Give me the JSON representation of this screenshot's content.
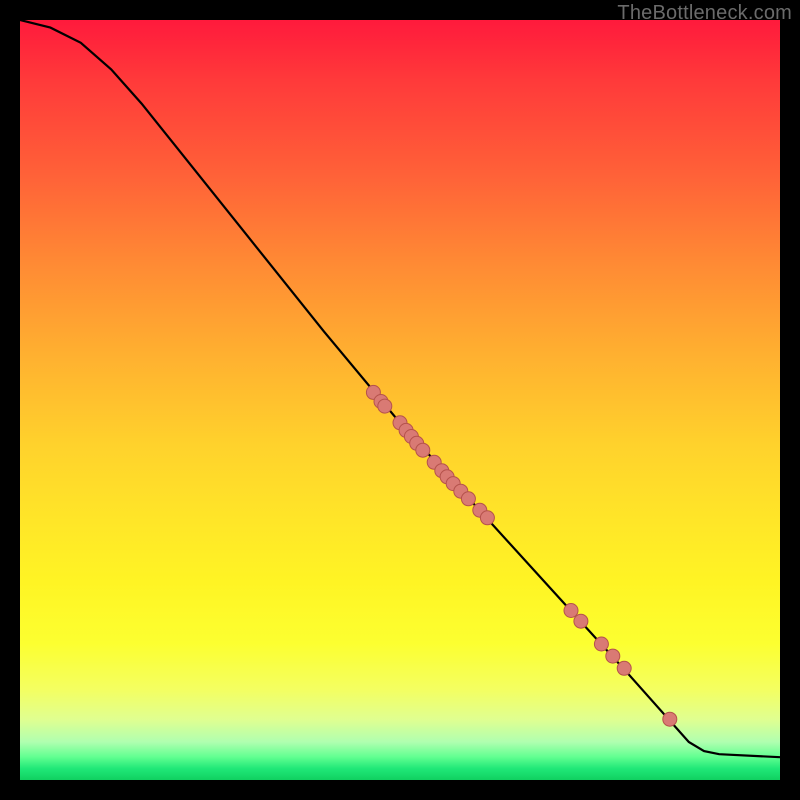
{
  "watermark": "TheBottleneck.com",
  "colors": {
    "point_fill": "#d97a74",
    "point_stroke": "#b5524c",
    "curve": "#000000"
  },
  "chart_data": {
    "type": "line",
    "title": "",
    "xlabel": "",
    "ylabel": "",
    "xlim": [
      0,
      100
    ],
    "ylim": [
      0,
      100
    ],
    "curve": [
      {
        "x": 0,
        "y": 100
      },
      {
        "x": 4,
        "y": 99
      },
      {
        "x": 8,
        "y": 97
      },
      {
        "x": 12,
        "y": 93.5
      },
      {
        "x": 16,
        "y": 89
      },
      {
        "x": 20,
        "y": 84
      },
      {
        "x": 30,
        "y": 71.5
      },
      {
        "x": 40,
        "y": 59
      },
      {
        "x": 50,
        "y": 47
      },
      {
        "x": 60,
        "y": 36
      },
      {
        "x": 70,
        "y": 25
      },
      {
        "x": 80,
        "y": 14
      },
      {
        "x": 88,
        "y": 5
      },
      {
        "x": 90,
        "y": 3.8
      },
      {
        "x": 92,
        "y": 3.4
      },
      {
        "x": 100,
        "y": 3
      }
    ],
    "points": [
      {
        "x": 46.5,
        "y": 51.0,
        "cluster": 1
      },
      {
        "x": 47.5,
        "y": 49.8,
        "cluster": 1
      },
      {
        "x": 48.0,
        "y": 49.2,
        "cluster": 1
      },
      {
        "x": 50.0,
        "y": 47.0,
        "cluster": 2
      },
      {
        "x": 50.8,
        "y": 46.0,
        "cluster": 2
      },
      {
        "x": 51.5,
        "y": 45.2,
        "cluster": 2
      },
      {
        "x": 52.2,
        "y": 44.3,
        "cluster": 2
      },
      {
        "x": 53.0,
        "y": 43.4,
        "cluster": 2
      },
      {
        "x": 54.5,
        "y": 41.8,
        "cluster": 3
      },
      {
        "x": 55.5,
        "y": 40.7,
        "cluster": 3
      },
      {
        "x": 56.2,
        "y": 39.9,
        "cluster": 3
      },
      {
        "x": 57.0,
        "y": 39.0,
        "cluster": 3
      },
      {
        "x": 58.0,
        "y": 38.0,
        "cluster": 3
      },
      {
        "x": 59.0,
        "y": 37.0,
        "cluster": 3
      },
      {
        "x": 60.5,
        "y": 35.5,
        "cluster": 3
      },
      {
        "x": 61.5,
        "y": 34.5,
        "cluster": 3
      },
      {
        "x": 72.5,
        "y": 22.3,
        "cluster": 4
      },
      {
        "x": 73.8,
        "y": 20.9,
        "cluster": 4
      },
      {
        "x": 76.5,
        "y": 17.9,
        "cluster": 5
      },
      {
        "x": 78.0,
        "y": 16.3,
        "cluster": 5
      },
      {
        "x": 79.5,
        "y": 14.7,
        "cluster": 5
      },
      {
        "x": 85.5,
        "y": 8.0,
        "cluster": 6
      }
    ]
  }
}
